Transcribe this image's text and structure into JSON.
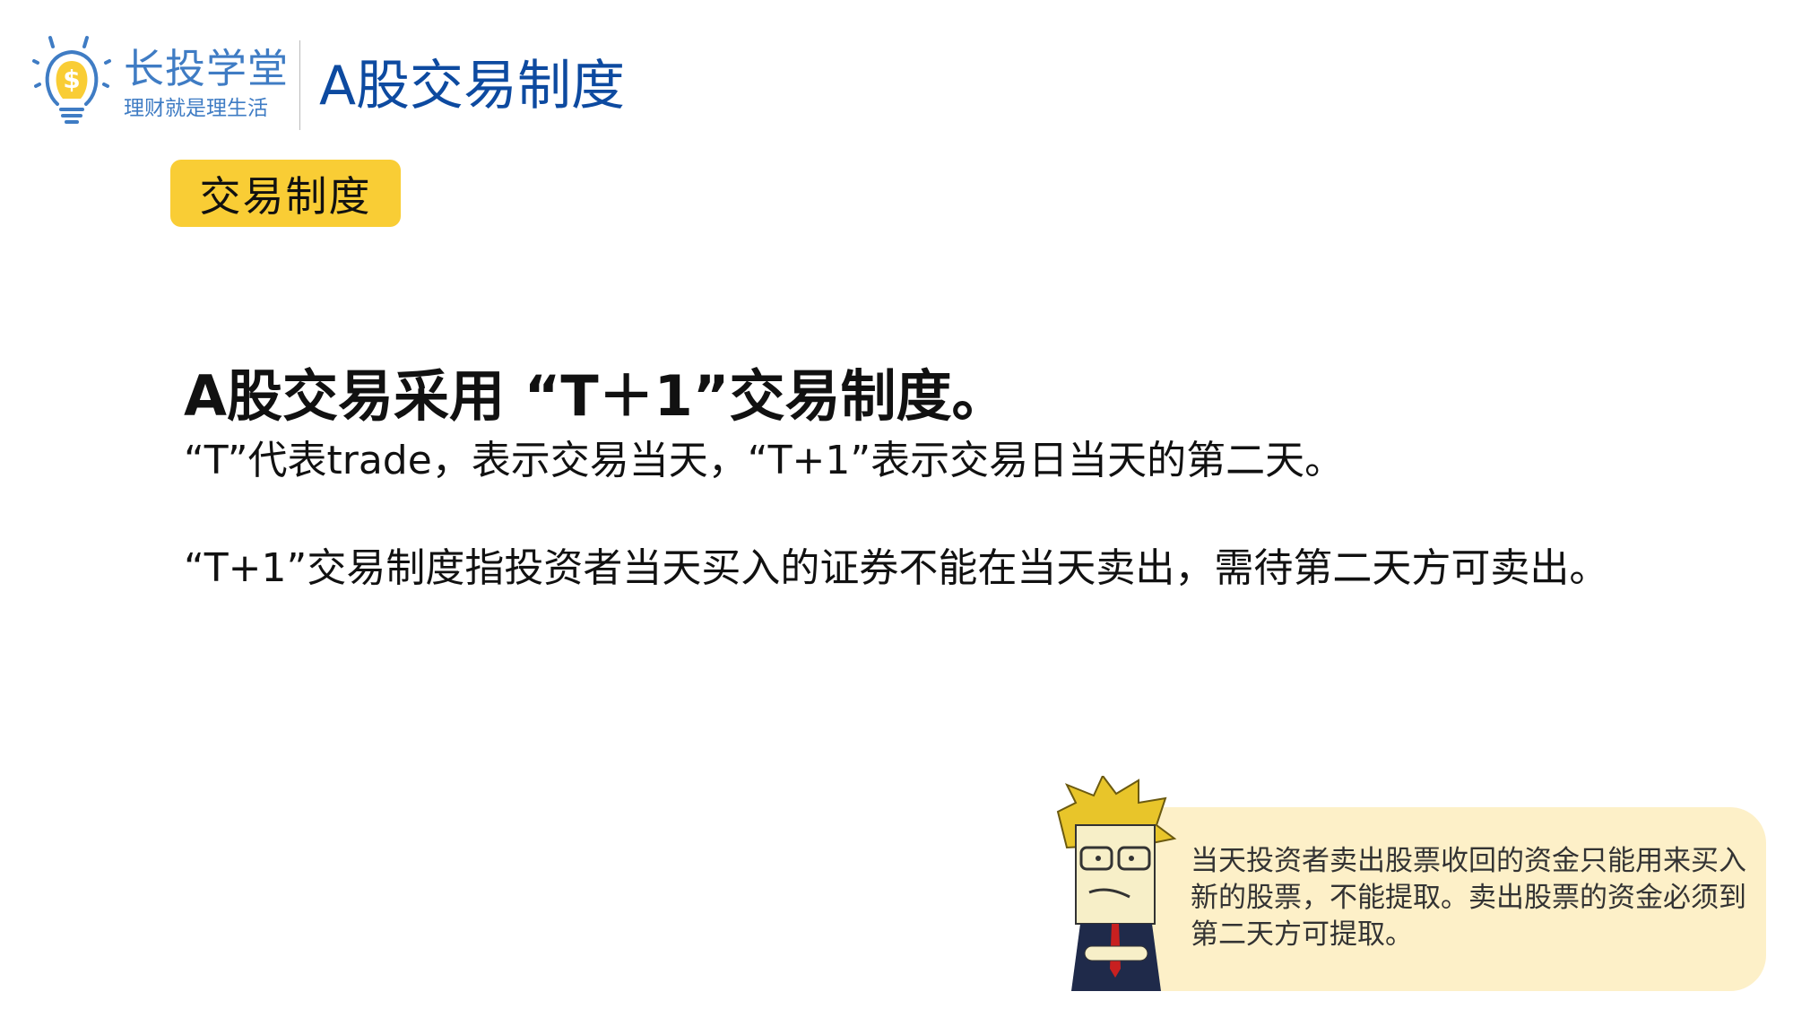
{
  "header": {
    "brand_name": "长投学堂",
    "brand_slogan": "理财就是理生活",
    "title": "A股交易制度"
  },
  "section_tag": "交易制度",
  "main": {
    "heading": "A股交易采用 “T＋1”交易制度。",
    "line1": "“T”代表trade，表示交易当天，“T+1”表示交易日当天的第二天。",
    "paragraph2": "“T+1”交易制度指投资者当天买入的证券不能在当天卖出，需待第二天方可卖出。"
  },
  "tip_bubble": {
    "text": "当天投资者卖出股票收回的资金只能用来买入新的股票，不能提取。卖出股票的资金必须到第二天方可提取。"
  },
  "colors": {
    "brand_blue": "#3f7cc4",
    "title_blue": "#0d4aa0",
    "tag_yellow": "#f9cd35",
    "bubble_bg": "#fdf0c8"
  }
}
